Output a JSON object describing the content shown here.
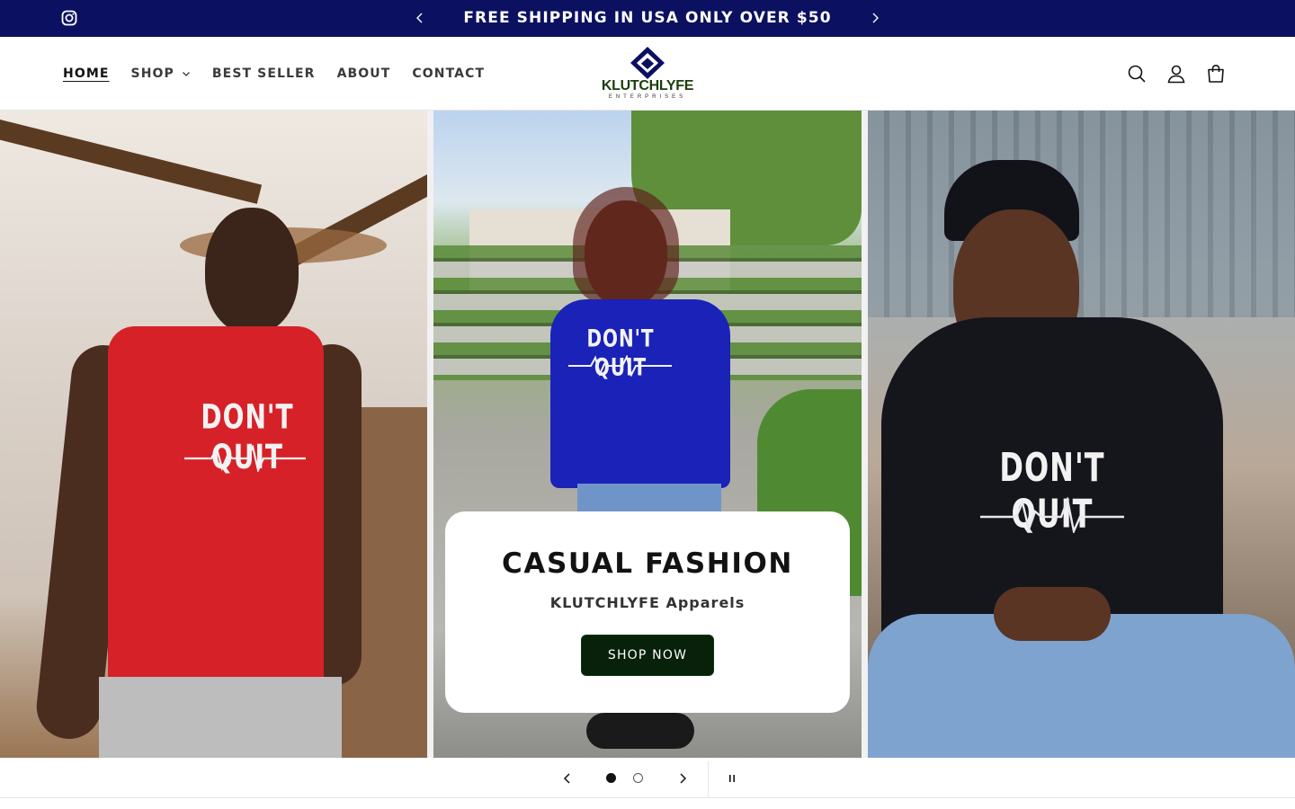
{
  "announcement": {
    "message": "FREE SHIPPING IN USA ONLY OVER $50",
    "social_icon": "instagram-icon",
    "prev_icon": "chevron-left-icon",
    "next_icon": "chevron-right-icon"
  },
  "header": {
    "nav": [
      {
        "label": "HOME",
        "active": true
      },
      {
        "label": "SHOP",
        "has_dropdown": true
      },
      {
        "label": "BEST SELLER"
      },
      {
        "label": "ABOUT"
      },
      {
        "label": "CONTACT"
      }
    ],
    "logo": {
      "brand": "KLUTCHLYFE",
      "sub": "ENTERPRISES"
    },
    "icons": [
      "search-icon",
      "account-icon",
      "cart-icon"
    ]
  },
  "hero": {
    "slides": [
      {
        "shirt_text": "DON'T QUIT",
        "shirt_color": "#d62128"
      },
      {
        "shirt_text": "DON'T QUIT",
        "shirt_color": "#1a22b8"
      },
      {
        "shirt_text": "DON'T QUIT",
        "shirt_color": "#15161c"
      }
    ],
    "card": {
      "heading": "CASUAL FASHION",
      "subheading": "KLUTCHLYFE Apparels",
      "button": "SHOP NOW"
    }
  },
  "slider_controls": {
    "current": 1,
    "total": 2,
    "icons": [
      "chevron-left-icon",
      "chevron-right-icon",
      "pause-icon"
    ]
  },
  "colors": {
    "announcement_bg": "#0b1160",
    "button_bg": "#07210a",
    "logo_green": "#1a3d0a"
  }
}
